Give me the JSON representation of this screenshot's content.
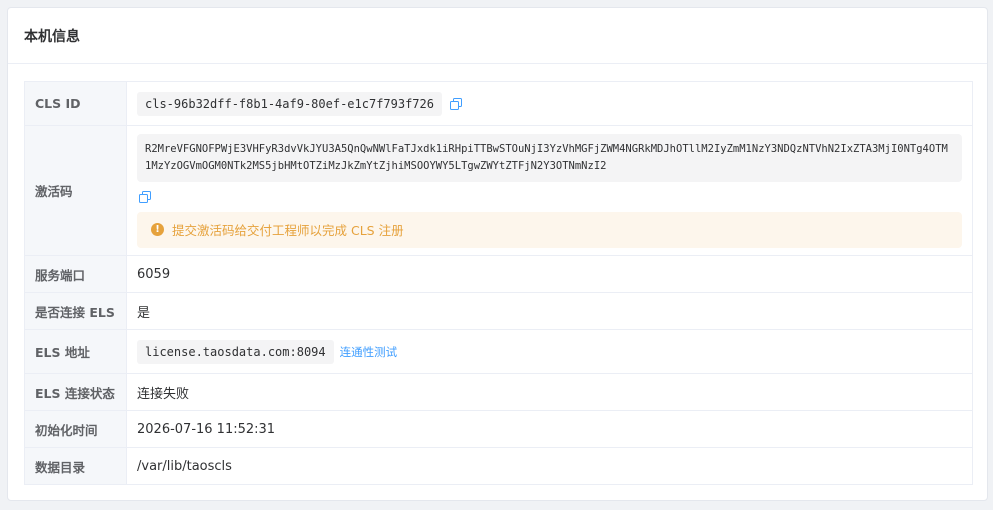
{
  "card": {
    "title": "本机信息"
  },
  "rows": {
    "cls_id": {
      "label": "CLS ID",
      "value": "cls-96b32dff-f8b1-4af9-80ef-e1c7f793f726"
    },
    "activation": {
      "label": "激活码",
      "value": "R2MreVFGNOFPWjE3VHFyR3dvVkJYU3A5QnQwNWlFaTJxdk1iRHpiTTBwSTOuNjI3YzVhMGFjZWM4NGRkMDJhOTllM2IyZmM1NzY3NDQzNTVhN2IxZTA3MjI0NTg4OTM1MzYzOGVmOGM0NTk2MS5jbHMtOTZiMzJkZmYtZjhiMSOOYWY5LTgwZWYtZTFjN2Y3OTNmNzI2",
      "alert": "提交激活码给交付工程师以完成 CLS 注册"
    },
    "port": {
      "label": "服务端口",
      "value": "6059"
    },
    "els_connected": {
      "label": "是否连接 ELS",
      "value": "是"
    },
    "els_address": {
      "label": "ELS 地址",
      "value": "license.taosdata.com:8094",
      "test_link": "连通性测试"
    },
    "els_status": {
      "label": "ELS 连接状态",
      "value": "连接失败"
    },
    "init_time": {
      "label": "初始化时间",
      "value": "2026-07-16 11:52:31"
    },
    "data_dir": {
      "label": "数据目录",
      "value": "/var/lib/taoscls"
    }
  },
  "icons": {
    "copy": "copy-icon",
    "warning": "warning-circle-icon"
  },
  "colors": {
    "link": "#409eff",
    "warning": "#e6a23c",
    "warning_bg": "#fdf6ec",
    "label_bg": "#f5f7fa"
  }
}
